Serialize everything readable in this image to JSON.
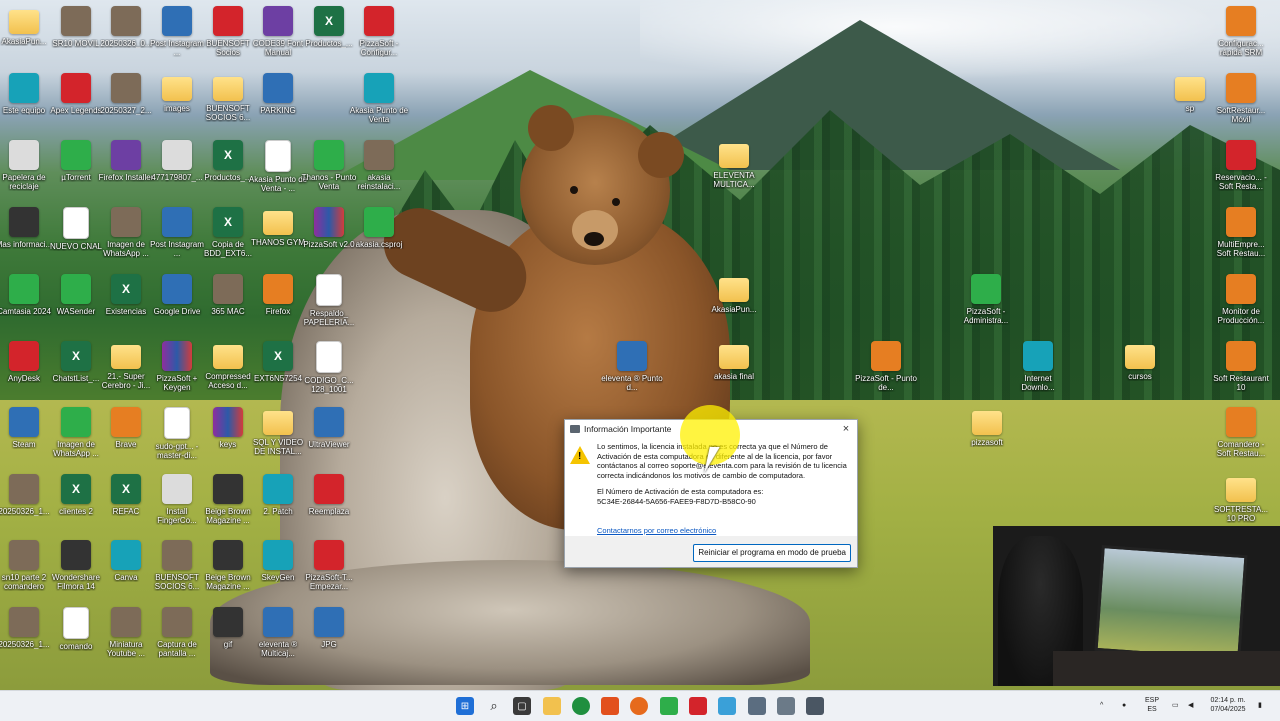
{
  "desktop": {
    "icons": [
      {
        "label": "AkasiaPun...",
        "type": "folder"
      },
      {
        "label": "SR10 MOVIL",
        "type": "img"
      },
      {
        "label": "20250326_0...",
        "type": "img"
      },
      {
        "label": "Post Instagram ...",
        "type": "app"
      },
      {
        "label": "BUENSOFT Socios",
        "type": "red"
      },
      {
        "label": "CODE39 Font Manual",
        "type": "purple"
      },
      {
        "label": "Productos_...",
        "type": "excel"
      },
      {
        "label": "PizzaSoft - Configur...",
        "type": "red"
      },
      {
        "label": "Este equipo",
        "type": "teal"
      },
      {
        "label": "Apex Legends",
        "type": "red"
      },
      {
        "label": "20250327_2...",
        "type": "img"
      },
      {
        "label": "images",
        "type": "folder"
      },
      {
        "label": "BUENSOFT SOCIOS 6...",
        "type": "folder"
      },
      {
        "label": "PARKING",
        "type": "app"
      },
      {
        "label": "Akasia Punto de Venta",
        "type": "teal"
      },
      {
        "label": "Papelera de reciclaje",
        "type": "gray"
      },
      {
        "label": "µTorrent",
        "type": "green"
      },
      {
        "label": "Firefox Installer",
        "type": "purple"
      },
      {
        "label": "477179807_...",
        "type": "gray"
      },
      {
        "label": "Productos_...",
        "type": "excel"
      },
      {
        "label": "Akasia Punto de Venta - ...",
        "type": "doc"
      },
      {
        "label": "Thanos - Punto Venta",
        "type": "green"
      },
      {
        "label": "akasia reinstalaci...",
        "type": "img"
      },
      {
        "label": "Mas informaci...",
        "type": "dark"
      },
      {
        "label": "NUEVO CNAL",
        "type": "doc"
      },
      {
        "label": "Imagen de WhatsApp ...",
        "type": "img"
      },
      {
        "label": "Post Instagram ...",
        "type": "app"
      },
      {
        "label": "Copia de BDD_EXT6...",
        "type": "excel"
      },
      {
        "label": "THANOS GYM",
        "type": "folder"
      },
      {
        "label": "PizzaSoft v2.0",
        "type": "winrar"
      },
      {
        "label": "akasia.csproj",
        "type": "green"
      },
      {
        "label": "Camtasia 2024",
        "type": "green"
      },
      {
        "label": "WASender",
        "type": "green"
      },
      {
        "label": "Existencias",
        "type": "excel"
      },
      {
        "label": "Google Drive",
        "type": "app"
      },
      {
        "label": "365 MAC",
        "type": "img"
      },
      {
        "label": "Firefox",
        "type": "orange"
      },
      {
        "label": "Respaldo_ PAPELERIA...",
        "type": "doc"
      },
      {
        "label": "AnyDesk",
        "type": "red"
      },
      {
        "label": "ChatstList_...",
        "type": "excel"
      },
      {
        "label": "21.- Super Cerebro - Ji...",
        "type": "folder"
      },
      {
        "label": "PizzaSoft + Keygen",
        "type": "winrar"
      },
      {
        "label": "Compressed Acceso d...",
        "type": "folder"
      },
      {
        "label": "EXT6N57254",
        "type": "excel"
      },
      {
        "label": "CODIGO_C... 128_1001",
        "type": "doc"
      },
      {
        "label": "Steam",
        "type": "app"
      },
      {
        "label": "Imagen de WhatsApp ...",
        "type": "green"
      },
      {
        "label": "Brave",
        "type": "orange"
      },
      {
        "label": "sudo-gpt... -master-di...",
        "type": "doc"
      },
      {
        "label": "keys",
        "type": "winrar"
      },
      {
        "label": "SQL Y VIDEO DE INSTAL...",
        "type": "folder"
      },
      {
        "label": "UltraViewer",
        "type": "app"
      },
      {
        "label": "20250326_1...",
        "type": "img"
      },
      {
        "label": "clientes 2",
        "type": "excel"
      },
      {
        "label": "REFAC",
        "type": "excel"
      },
      {
        "label": "Install FingerCo...",
        "type": "gray"
      },
      {
        "label": "Beige Brown Magazine ...",
        "type": "dark"
      },
      {
        "label": "2. Patch",
        "type": "teal"
      },
      {
        "label": "Reemplaza",
        "type": "red"
      },
      {
        "label": "sn10 parte 2 comandero",
        "type": "img"
      },
      {
        "label": "Wondershare Filmora 14",
        "type": "dark"
      },
      {
        "label": "Canva",
        "type": "teal"
      },
      {
        "label": "BUENSOFT SOCIOS 6...",
        "type": "img"
      },
      {
        "label": "Beige Brown Magazine ...",
        "type": "dark"
      },
      {
        "label": "SkeyGen",
        "type": "teal"
      },
      {
        "label": "PizzaSoft-T... Empezar...",
        "type": "red"
      },
      {
        "label": "20250326_1...",
        "type": "img"
      },
      {
        "label": "comando",
        "type": "doc"
      },
      {
        "label": "Miniatura Youtube ...",
        "type": "img"
      },
      {
        "label": "Captura de pantalla ...",
        "type": "img"
      },
      {
        "label": "gif",
        "type": "dark"
      },
      {
        "label": "eleventa ® Multicaj...",
        "type": "app"
      },
      {
        "label": "JPG",
        "type": "app"
      },
      {
        "label": "ELEVENTA MULTICA...",
        "type": "folder"
      },
      {
        "label": "AkasiaPun...",
        "type": "folder"
      },
      {
        "label": "eleventa ® Punto d...",
        "type": "app"
      },
      {
        "label": "akasia final",
        "type": "folder"
      },
      {
        "label": "PizzaSoft - Administra...",
        "type": "green"
      },
      {
        "label": "PizzaSoft - Punto de...",
        "type": "orange"
      },
      {
        "label": "Internet Downlo...",
        "type": "teal"
      },
      {
        "label": "cursos",
        "type": "folder"
      },
      {
        "label": "pizzasoft",
        "type": "folder"
      },
      {
        "label": "Configurac... rápida SRM",
        "type": "orange"
      },
      {
        "label": "sp",
        "type": "folder"
      },
      {
        "label": "SoftRestaur... Móvil",
        "type": "orange"
      },
      {
        "label": "Reservacio... - Soft Resta...",
        "type": "red"
      },
      {
        "label": "MultiEmpre... Soft Restau...",
        "type": "orange"
      },
      {
        "label": "Monitor de Producción...",
        "type": "orange"
      },
      {
        "label": "Soft Restaurant 10",
        "type": "orange"
      },
      {
        "label": "Comandero - Soft Restau...",
        "type": "orange"
      },
      {
        "label": "SOFTRESTA... 10 PRO",
        "type": "folder"
      }
    ]
  },
  "dialog": {
    "title": "Información Importante",
    "close_glyph": "×",
    "message_1": "Lo sentimos, la licencia instalada no es correcta ya que el Número de Activación de esta computadora es diferente al de la licencia, por favor contáctanos al correo soporte@eleventa.com para la revisión de tu licencia correcta indicándonos los motivos de cambio de computadora.",
    "message_2": "El Número de Activación de esta computadora es:",
    "activation_number": "5C34E-26844-5A656-FAEE9-F8D7D-B58C0-90",
    "link_text": "Contactarnos por correo electrónico",
    "button_label": "Reiniciar el programa en modo de prueba"
  },
  "taskbar": {
    "tray": {
      "language_top": "ESP",
      "language_bottom": "ES",
      "time": "02:14 p. m.",
      "date": "07/04/2025"
    }
  }
}
